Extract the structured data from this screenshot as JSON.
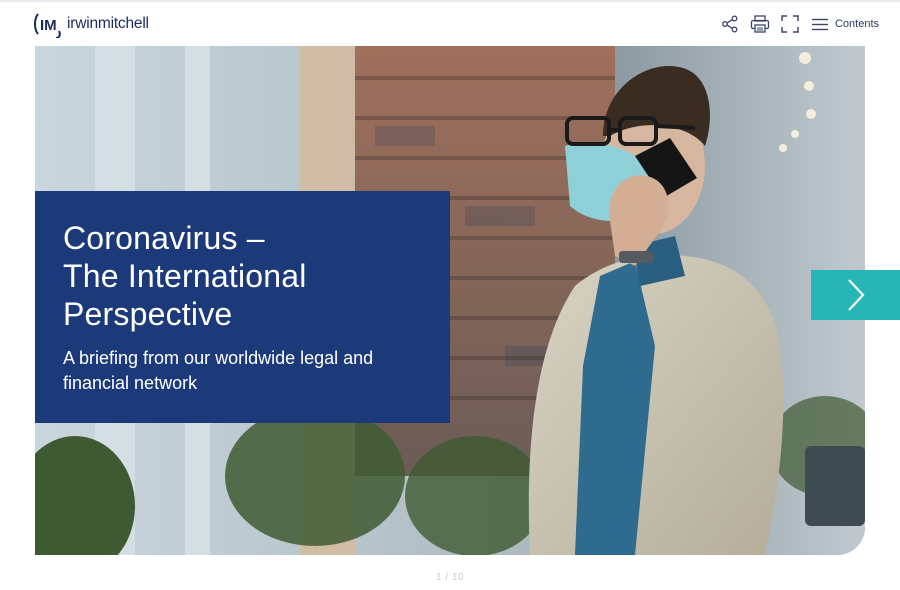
{
  "header": {
    "logo_text": "irwinmitchell",
    "logo_mark": "IM",
    "brand_color": "#1b2b5e",
    "tools": [
      {
        "name": "share-icon"
      },
      {
        "name": "print-icon"
      },
      {
        "name": "fullscreen-icon"
      }
    ],
    "contents_label": "Contents"
  },
  "hero": {
    "title_lines": [
      "Coronavirus –",
      "The International",
      "Perspective"
    ],
    "subtitle": "A briefing from our worldwide legal and financial network",
    "box_color": "#1c3a7a",
    "image": "man-in-face-mask-on-phone"
  },
  "navigation": {
    "next_icon": "chevron-right-icon",
    "accent_color": "#27b6b6"
  },
  "pager": {
    "text": "1 / 10"
  }
}
